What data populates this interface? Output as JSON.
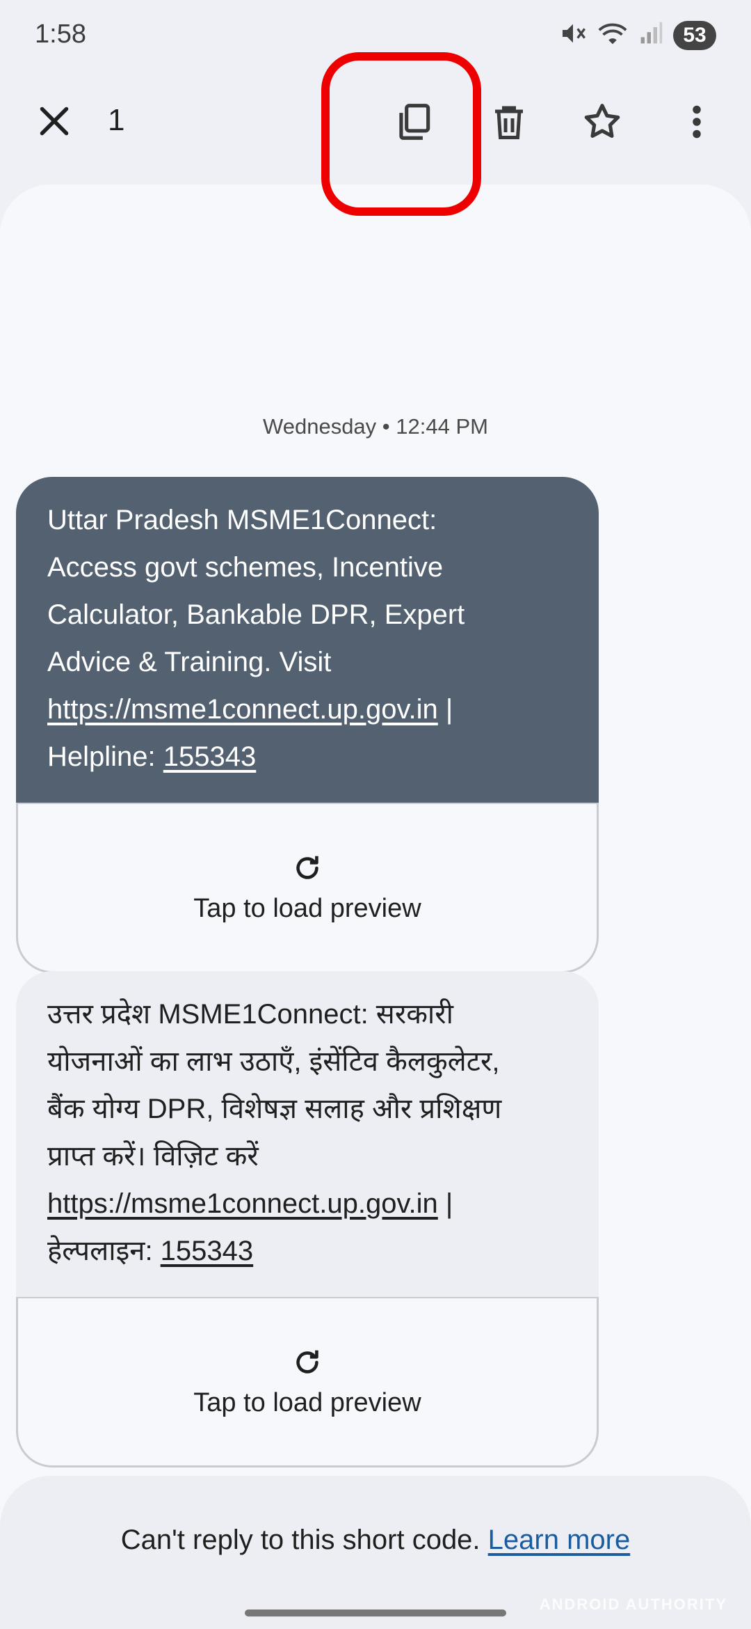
{
  "status_bar": {
    "time": "1:58",
    "battery": "53"
  },
  "action_bar": {
    "selected_count": "1",
    "icons": [
      "close-icon",
      "copy-icon",
      "delete-icon",
      "star-icon",
      "more-vert-icon"
    ]
  },
  "conversation": {
    "timestamp": "Wednesday • 12:44 PM",
    "messages": [
      {
        "lines": [
          "Uttar Pradesh MSME1Connect:",
          "Access govt schemes, Incentive",
          "Calculator, Bankable DPR, Expert",
          "Advice & Training. Visit"
        ],
        "link": "https://msme1connect.up.gov.in",
        "separator": " |",
        "helpline_label": "Helpline: ",
        "helpline_number": "155343",
        "preview_label": "Tap to load preview"
      },
      {
        "lines": [
          "उत्तर प्रदेश MSME1Connect: सरकारी",
          "योजनाओं का लाभ उठाएँ, इंसेंटिव कैलकुलेटर,",
          "बैंक योग्य DPR, विशेषज्ञ सलाह और प्रशिक्षण",
          "प्राप्त करें। विज़िट करें"
        ],
        "link": "https://msme1connect.up.gov.in",
        "separator": " |",
        "helpline_label": "हेल्पलाइन: ",
        "helpline_number": "155343",
        "preview_label": "Tap to load preview"
      }
    ]
  },
  "footer": {
    "reply_text": "Can't reply to this short code. ",
    "learn_more": "Learn more",
    "watermark": "ANDROID AUTHORITY"
  },
  "colors": {
    "highlight": "#ee0000",
    "incoming_bubble": "#536170",
    "link": "#1a5c9e"
  }
}
